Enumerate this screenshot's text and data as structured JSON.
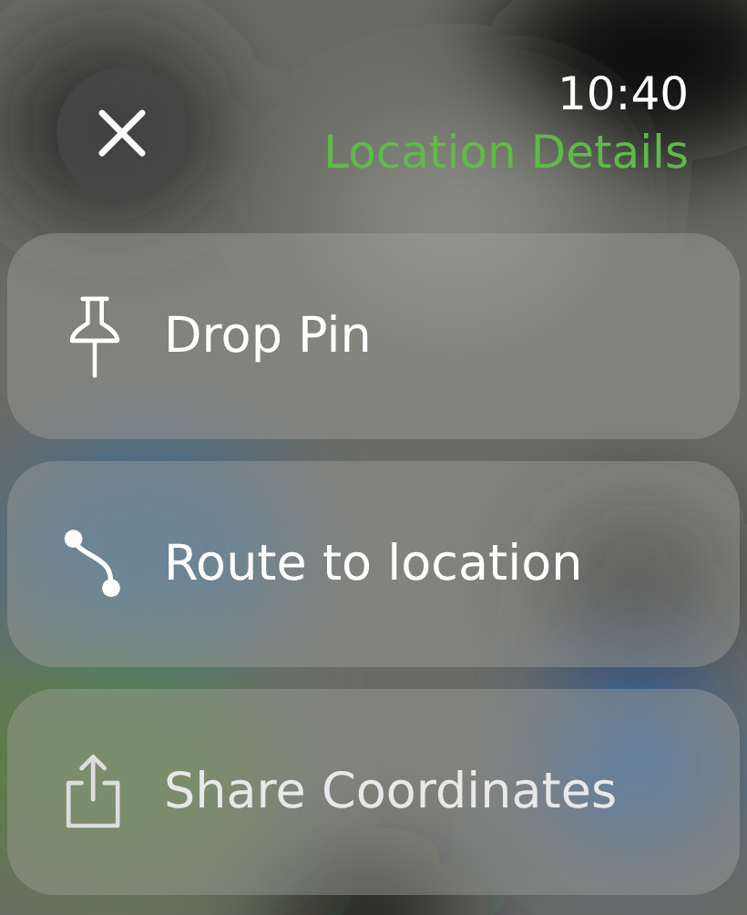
{
  "header": {
    "time": "10:40",
    "title": "Location Details"
  },
  "actions": [
    {
      "label": "Drop Pin",
      "kind": "pin"
    },
    {
      "label": "Route to location",
      "kind": "route"
    },
    {
      "label": "Share Coordinates",
      "kind": "share"
    }
  ]
}
